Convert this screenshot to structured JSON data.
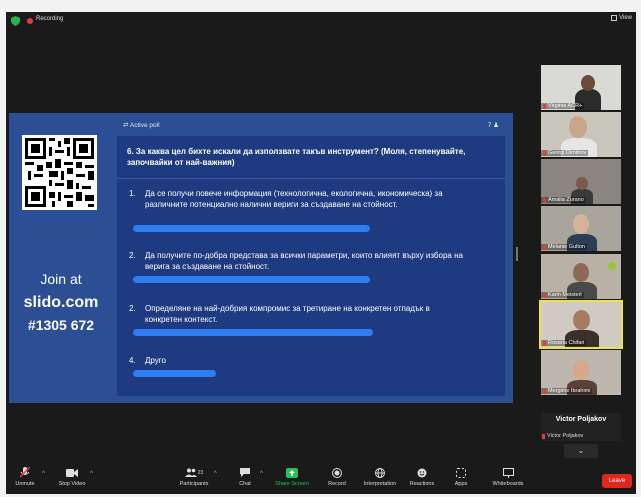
{
  "topbar": {
    "recording_label": "Recording",
    "view_label": "View"
  },
  "slido": {
    "join_label": "Join at",
    "site": "slido.com",
    "code": "#1305 672"
  },
  "poll": {
    "status_label": "Active poll",
    "participant_count": "7",
    "question": "6. За каква цел бихте искали да използвате такъв инструмент? (Моля, степенувайте, започвайки от най-важния)",
    "options": [
      {
        "number": "1.",
        "text": "Да се получи повече информация (технологична, екологична, икономическа) за различните потенциално налични вериги за създаване на стойност."
      },
      {
        "number": "2.",
        "text": "Да получите по-добра представа за всички параметри, които влияят върху избора на верига за създаване на стойност."
      },
      {
        "number": "2.",
        "text": "Определяне на най-добрия компромис за третиране на конкретен отпадък в конкретен контекст."
      },
      {
        "number": "4.",
        "text": "Друго"
      }
    ],
    "option_fill": [
      0.74,
      0.74,
      0.75,
      0.26
    ]
  },
  "participants": [
    {
      "name": "Virginia ACR+"
    },
    {
      "name": "Georgi Dimitrov"
    },
    {
      "name": "Amalia Zurano"
    },
    {
      "name": "Melanie Gulton"
    },
    {
      "name": "Karin Meisterl"
    },
    {
      "name": "Rosaria Chifari"
    },
    {
      "name": "Mergime Ibrahimi"
    }
  ],
  "speaker": {
    "name": "Victor Poljakov",
    "label": "Victor Poljakov"
  },
  "toolbar": {
    "unmute": "Unmute",
    "stop_video": "Stop Video",
    "participants": "Participants",
    "participants_count": "23",
    "chat": "Chat",
    "share_screen": "Share Screen",
    "record": "Record",
    "interpretation": "Interpretation",
    "reactions": "Reactions",
    "apps": "Apps",
    "whiteboards": "Whiteboards",
    "leave": "Leave"
  },
  "colors": {
    "slide_bg": "#2c4e95",
    "panel_bg": "#1e3a80",
    "bar": "#2d7ef0",
    "leave": "#e0261f",
    "share_green": "#23c15a"
  }
}
